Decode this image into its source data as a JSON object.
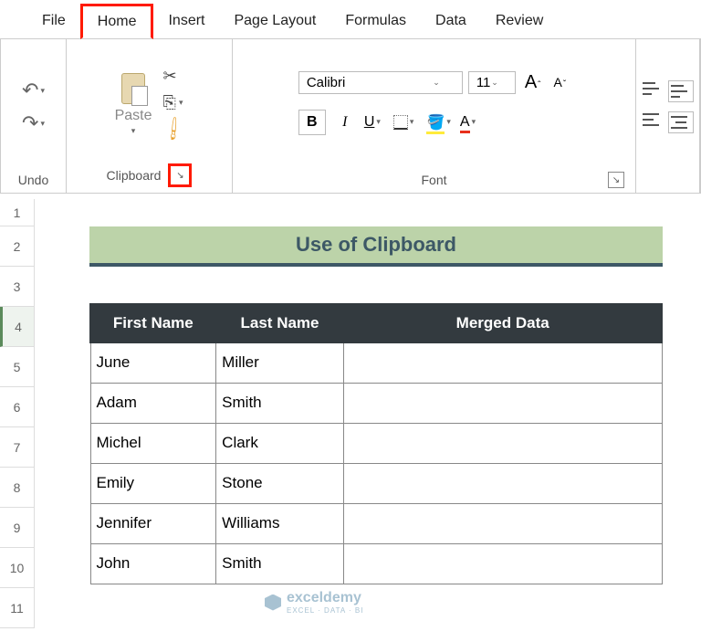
{
  "tabs": {
    "file": "File",
    "home": "Home",
    "insert": "Insert",
    "page_layout": "Page Layout",
    "formulas": "Formulas",
    "data": "Data",
    "review": "Review"
  },
  "ribbon": {
    "undo_label": "Undo",
    "clipboard_label": "Clipboard",
    "paste_label": "Paste",
    "font_label": "Font",
    "font_name": "Calibri",
    "font_size": "11",
    "bold": "B",
    "italic": "I",
    "underline": "U"
  },
  "sheet": {
    "title": "Use of Clipboard",
    "headers": {
      "first": "First Name",
      "last": "Last Name",
      "merged": "Merged Data"
    },
    "rows": [
      {
        "first": "June",
        "last": "Miller",
        "merged": ""
      },
      {
        "first": "Adam",
        "last": "Smith",
        "merged": ""
      },
      {
        "first": "Michel",
        "last": "Clark",
        "merged": ""
      },
      {
        "first": "Emily",
        "last": "Stone",
        "merged": ""
      },
      {
        "first": "Jennifer",
        "last": "Williams",
        "merged": ""
      },
      {
        "first": "John",
        "last": "Smith",
        "merged": ""
      }
    ],
    "row_nums": [
      "1",
      "2",
      "3",
      "4",
      "5",
      "6",
      "7",
      "8",
      "9",
      "10",
      "11"
    ]
  },
  "watermark": {
    "brand": "exceldemy",
    "tagline": "EXCEL · DATA · BI"
  }
}
